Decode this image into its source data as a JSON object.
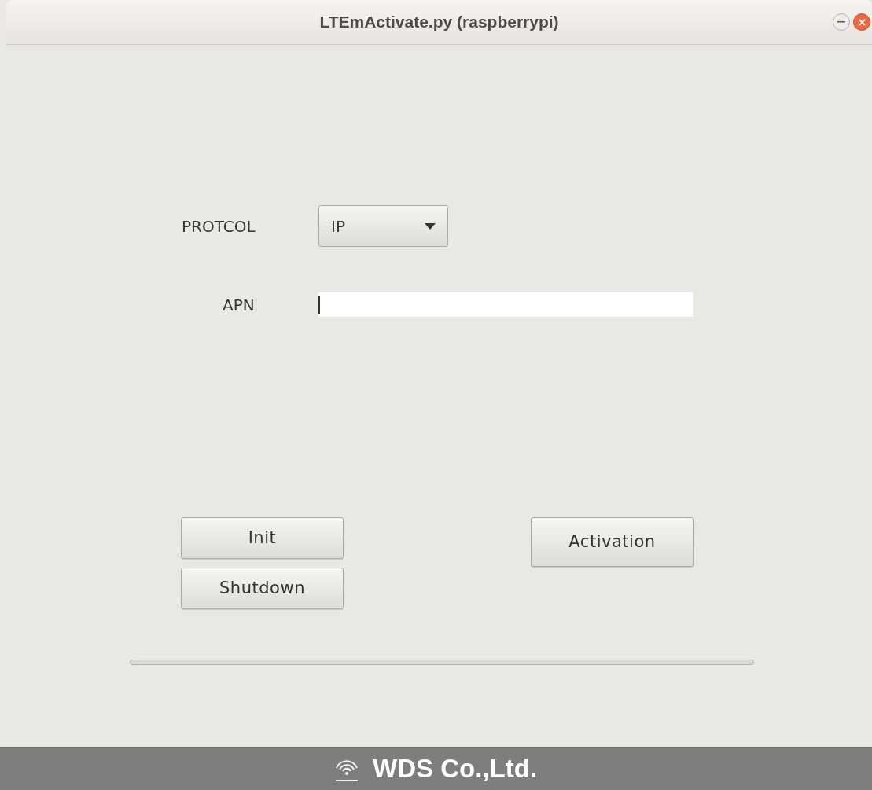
{
  "window": {
    "title": "LTEmActivate.py (raspberrypi)"
  },
  "protocol": {
    "label": "PROTCOL",
    "value": "IP"
  },
  "apn": {
    "label": "APN",
    "focused": true
  },
  "buttons": {
    "init": "Init",
    "shutdown": "Shutdown",
    "activation": "Activation"
  },
  "footer": {
    "company": "WDS Co.,Ltd."
  }
}
